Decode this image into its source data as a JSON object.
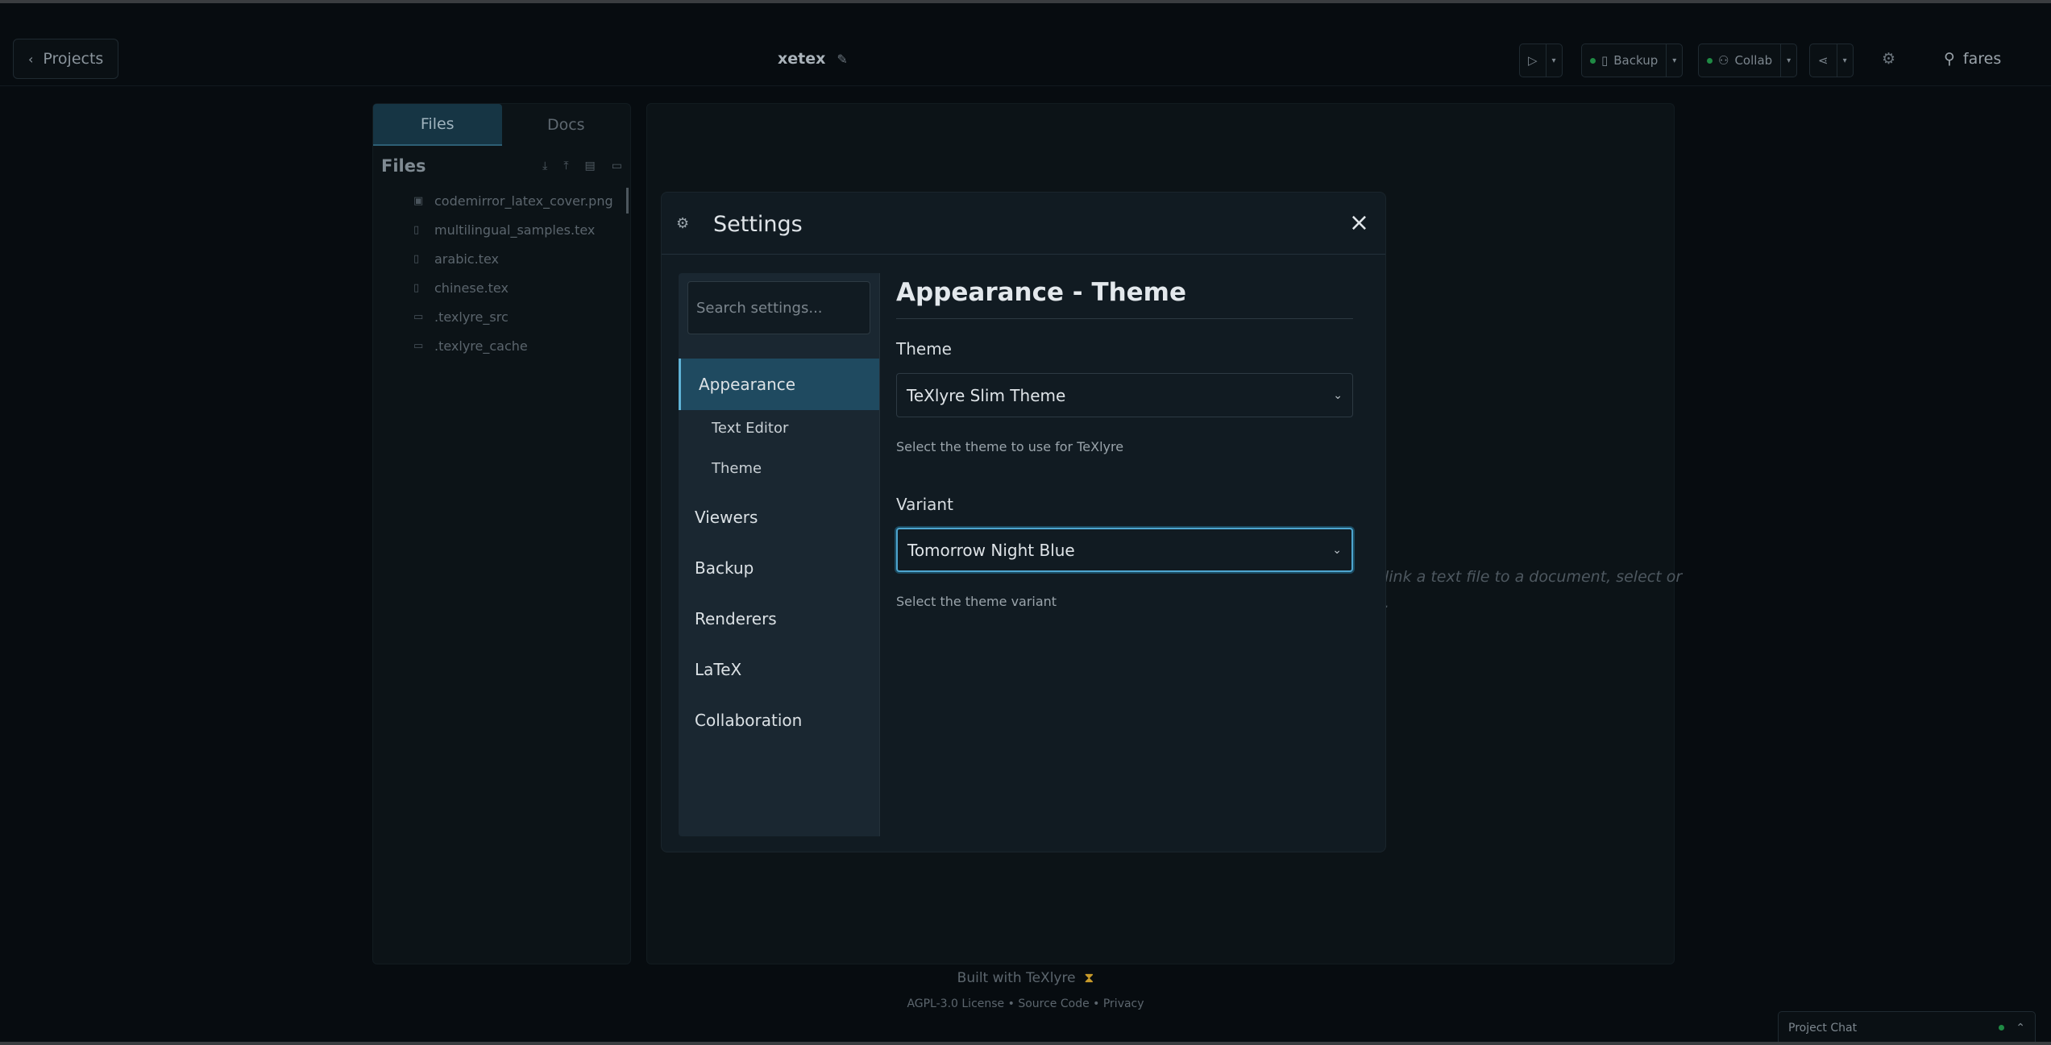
{
  "header": {
    "back_label": "Projects",
    "project_name": "xetex",
    "backup_label": "Backup",
    "collab_label": "Collab",
    "user_name": "fares"
  },
  "files_panel": {
    "tabs": [
      {
        "label": "Files",
        "active": true
      },
      {
        "label": "Docs",
        "active": false
      }
    ],
    "title": "Files",
    "items": [
      {
        "name": "codemirror_latex_cover.png",
        "kind": "image"
      },
      {
        "name": "multilingual_samples.tex",
        "kind": "file"
      },
      {
        "name": "arabic.tex",
        "kind": "file"
      },
      {
        "name": "chinese.tex",
        "kind": "file"
      },
      {
        "name": ".texlyre_src",
        "kind": "folder"
      },
      {
        "name": ".texlyre_cache",
        "kind": "folder"
      }
    ]
  },
  "main": {
    "hint_line1": "link a text file to a document, select or",
    "hint_line2": "."
  },
  "footer": {
    "built_with": "Built with TeXlyre",
    "links": "AGPL-3.0 License • Source Code • Privacy"
  },
  "chat": {
    "label": "Project Chat"
  },
  "settings_modal": {
    "title": "Settings",
    "search_placeholder": "Search settings...",
    "nav": [
      {
        "label": "Appearance",
        "active": true
      },
      {
        "label": "Viewers"
      },
      {
        "label": "Backup"
      },
      {
        "label": "Renderers"
      },
      {
        "label": "LaTeX"
      },
      {
        "label": "Collaboration"
      }
    ],
    "sub_nav": [
      "Text Editor",
      "Theme"
    ],
    "section_title": "Appearance - Theme",
    "theme": {
      "label": "Theme",
      "value": "TeXlyre Slim Theme",
      "help": "Select the theme to use for TeXlyre"
    },
    "variant": {
      "label": "Variant",
      "value": "Tomorrow Night Blue",
      "help": "Select the theme variant"
    }
  },
  "colors": {
    "accent": "#4ea5cf",
    "active_nav_bg": "#1f4a60",
    "status_green": "#1f8a44"
  }
}
